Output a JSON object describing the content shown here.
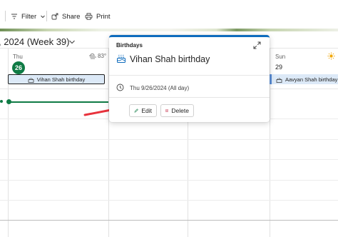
{
  "toolbar": {
    "filter_label": "Filter",
    "share_label": "Share",
    "print_label": "Print"
  },
  "header": {
    "week_title": ", 2024 (Week 39)"
  },
  "days": [
    {
      "name": "Thu",
      "date": "26",
      "weather": "83°",
      "today": true
    },
    {
      "name": "Sun",
      "date": "29",
      "weather": "",
      "today": false
    }
  ],
  "events": {
    "thu": "Vihan Shah birthday",
    "sun": "Aavyan Shah birthday"
  },
  "popup": {
    "category": "Birthdays",
    "title": "Vihan Shah birthday",
    "when": "Thu 9/26/2024 (All day)",
    "edit_label": "Edit",
    "delete_label": "Delete"
  },
  "colors": {
    "accent": "#0f6cbd",
    "today": "#0f7b45",
    "event_fill": "#dce9f7",
    "annotation_arrow": "#e8323c"
  },
  "icons": [
    "filter-icon",
    "share-icon",
    "print-icon",
    "chevron-down-icon",
    "cloud-icon",
    "sun-icon",
    "cake-icon",
    "expand-icon",
    "clock-icon",
    "edit-icon",
    "delete-icon"
  ]
}
